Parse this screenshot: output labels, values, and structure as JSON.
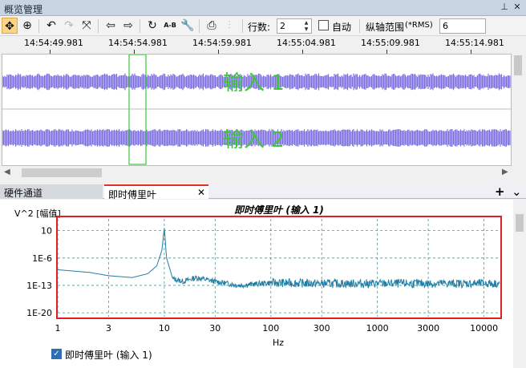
{
  "window": {
    "title": "概览管理",
    "pin_icon": "pin-icon",
    "close_icon": "close-icon"
  },
  "toolbar": {
    "rows_label": "行数:",
    "rows_value": "2",
    "auto_label": "自动",
    "yrange_label": "纵轴范围",
    "yrange_suffix": "(*RMS)",
    "yrange_value": "6",
    "ab_label": "A-B"
  },
  "overview": {
    "time_ticks": [
      "14:54:49.981",
      "14:54:54.981",
      "14:54:59.981",
      "14:55:04.981",
      "14:55:09.981",
      "14:55:14.981"
    ],
    "channels": [
      {
        "label": "输入 1",
        "color": "#7b6ee0"
      },
      {
        "label": "输入 2",
        "color": "#7b6ee0"
      }
    ],
    "label_color": "#3ec43e",
    "selection_color": "#3ec43e"
  },
  "tabs": [
    {
      "label": "硬件通道"
    },
    {
      "label": "即时傅里叶"
    }
  ],
  "tabbar": {
    "add_icon": "+",
    "dropdown_icon": "⌄",
    "close_icon": "✕"
  },
  "chart_data": {
    "type": "line",
    "title": "即时傅里叶 (输入 1)",
    "ylabel": "V^2 [幅值]",
    "xlabel": "Hz",
    "xscale": "log",
    "yscale": "log",
    "xlim": [
      1,
      14000
    ],
    "ylim": [
      1e-21,
      10000.0
    ],
    "x_ticks": [
      "1",
      "3",
      "10",
      "30",
      "100",
      "300",
      "1000",
      "3000",
      "10000"
    ],
    "y_ticks": [
      "10",
      "1E-6",
      "1E-13",
      "1E-20"
    ],
    "grid": true,
    "border_color": "#e02020",
    "series": [
      {
        "name": "即时傅里叶 (输入 1)",
        "color": "#1f7fa6",
        "x": [
          1,
          2,
          3,
          5,
          7,
          8.5,
          9.5,
          10,
          10.5,
          12,
          15,
          20,
          30,
          50,
          100,
          300,
          1000,
          3000,
          10000,
          14000
        ],
        "y": [
          1e-09,
          2e-10,
          3e-11,
          1e-11,
          1e-10,
          1e-08,
          0.0001,
          50.0,
          1e-06,
          5e-12,
          1e-12,
          1e-11,
          1e-12,
          1e-13,
          5e-13,
          3e-13,
          3e-13,
          3e-13,
          3e-13,
          3e-13
        ]
      }
    ],
    "legend": {
      "checked": true,
      "placement": "bottom-left"
    }
  }
}
